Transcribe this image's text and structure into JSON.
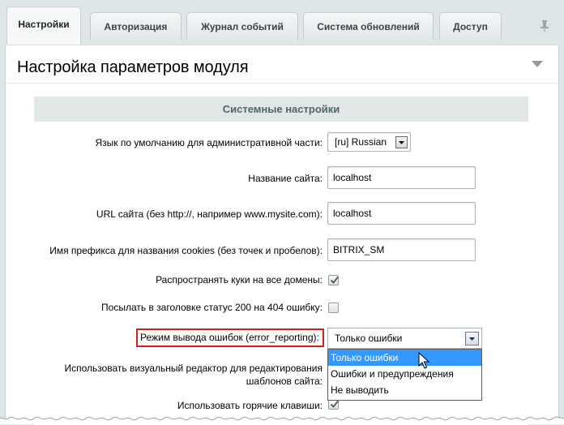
{
  "tabs": [
    {
      "label": "Настройки",
      "active": true
    },
    {
      "label": "Авторизация",
      "active": false
    },
    {
      "label": "Журнал событий",
      "active": false
    },
    {
      "label": "Система обновлений",
      "active": false
    },
    {
      "label": "Доступ",
      "active": false
    }
  ],
  "panel": {
    "title": "Настройка параметров модуля",
    "section_title": "Системные настройки"
  },
  "fields": {
    "language": {
      "label": "Язык по умолчанию для административной части:",
      "value": "[ru] Russian"
    },
    "site_name": {
      "label": "Название сайта:",
      "value": "localhost"
    },
    "site_url": {
      "label": "URL сайта (без http://, например www.mysite.com):",
      "value": "localhost"
    },
    "cookie_prefix": {
      "label": "Имя префикса для названия cookies (без точек и пробелов):",
      "value": "BITRIX_SM"
    },
    "cookies_all_domains": {
      "label": "Распространять куки на все домены:",
      "checked": true
    },
    "status_200_on_404": {
      "label": "Посылать в заголовке статус 200 на 404 ошибку:",
      "checked": false
    },
    "error_reporting": {
      "label": "Режим вывода ошибок (error_reporting):",
      "value": "Только ошибки",
      "options": [
        "Только ошибки",
        "Ошибки и предупреждения",
        "Не выводить"
      ],
      "highlighted_option": 0
    },
    "visual_editor": {
      "label": "Использовать визуальный редактор для редактирования шаблонов сайта:"
    },
    "hotkeys": {
      "label": "Использовать горячие клавиши:",
      "checked": true
    }
  },
  "colors": {
    "highlight_border": "#d21f1f",
    "option_selected": "#3399ff",
    "section_header_bg": "#e1e6e7"
  }
}
